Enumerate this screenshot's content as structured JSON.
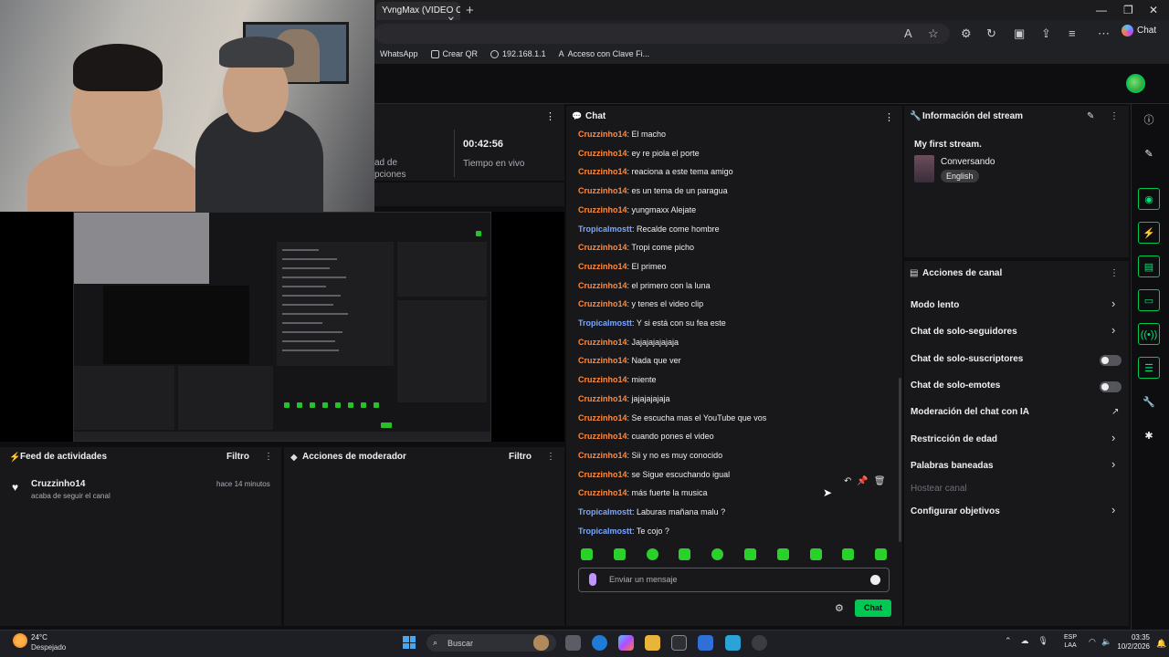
{
  "browser": {
    "tab_title": "YvngMax (VIDEO OF",
    "tab_close": "✕",
    "new_tab": "+",
    "copilot_label": "Chat",
    "bookmarks": [
      "WhatsApp",
      "Crear QR",
      "192.168.1.1",
      "Acceso con Clave Fi..."
    ]
  },
  "stats": {
    "label_partial": "ad de\npciones",
    "uptime": "00:42:56",
    "uptime_label": "Tiempo en vivo"
  },
  "activity": {
    "title": "Feed de actividades",
    "filter": "Filtro",
    "event_user": "Cruzzinho14",
    "event_text": "acaba de seguir el canal",
    "event_time": "hace 14 minutos"
  },
  "mod_actions": {
    "title": "Acciones de moderador",
    "filter": "Filtro"
  },
  "chat": {
    "title": "Chat",
    "messages": [
      {
        "user": "Cruzzinho14",
        "color": "cruz",
        "text": "El macho"
      },
      {
        "user": "Cruzzinho14",
        "color": "cruz",
        "text": "ey re piola el porte"
      },
      {
        "user": "Cruzzinho14",
        "color": "cruz",
        "text": "reaciona a este tema amigo"
      },
      {
        "user": "Cruzzinho14",
        "color": "cruz",
        "text": "es un tema de un paragua"
      },
      {
        "user": "Cruzzinho14",
        "color": "cruz",
        "text": "yungmaxx Alejate"
      },
      {
        "user": "Tropicalmostt",
        "color": "trop",
        "text": "Recalde come hombre"
      },
      {
        "user": "Cruzzinho14",
        "color": "cruz",
        "text": "Tropi come picho"
      },
      {
        "user": "Cruzzinho14",
        "color": "cruz",
        "text": "El primeo"
      },
      {
        "user": "Cruzzinho14",
        "color": "cruz",
        "text": "el primero con la luna"
      },
      {
        "user": "Cruzzinho14",
        "color": "cruz",
        "text": "y tenes el video clip"
      },
      {
        "user": "Tropicalmostt",
        "color": "trop",
        "text": "Y si está con su fea este"
      },
      {
        "user": "Cruzzinho14",
        "color": "cruz",
        "text": "Jajajajajajaja"
      },
      {
        "user": "Cruzzinho14",
        "color": "cruz",
        "text": "Nada que ver"
      },
      {
        "user": "Cruzzinho14",
        "color": "cruz",
        "text": "miente"
      },
      {
        "user": "Cruzzinho14",
        "color": "cruz",
        "text": "jajajajajaja"
      },
      {
        "user": "Cruzzinho14",
        "color": "cruz",
        "text": "Se escucha mas el YouTube que vos"
      },
      {
        "user": "Cruzzinho14",
        "color": "cruz",
        "text": "cuando pones el video"
      },
      {
        "user": "Cruzzinho14",
        "color": "cruz",
        "text": "Sii y no es muy conocido"
      },
      {
        "user": "Cruzzinho14",
        "color": "cruz",
        "text": "se Sigue escuchando igual"
      },
      {
        "user": "Cruzzinho14",
        "color": "cruz",
        "text": "más fuerte la musica"
      },
      {
        "user": "Tropicalmostt",
        "color": "trop",
        "text": "Laburas mañana malu ?"
      },
      {
        "user": "Tropicalmostt",
        "color": "trop",
        "text": "Te cojo ?"
      }
    ],
    "input_placeholder": "Enviar un mensaje",
    "send_label": "Chat"
  },
  "stream_info": {
    "title": "Información del stream",
    "stream_title": "My first stream.",
    "category": "Conversando",
    "language": "English"
  },
  "channel_actions": {
    "title": "Acciones de canal",
    "items": [
      {
        "label": "Modo lento",
        "control": "chevron"
      },
      {
        "label": "Chat de solo-seguidores",
        "control": "chevron"
      },
      {
        "label": "Chat de solo-suscriptores",
        "control": "toggle"
      },
      {
        "label": "Chat de solo-emotes",
        "control": "toggle"
      },
      {
        "label": "Moderación del chat con IA",
        "control": "external"
      },
      {
        "label": "Restricción de edad",
        "control": "chevron"
      },
      {
        "label": "Palabras baneadas",
        "control": "chevron"
      },
      {
        "label": "Hostear canal",
        "control": "disabled"
      },
      {
        "label": "Configurar objetivos",
        "control": "chevron"
      }
    ]
  },
  "taskbar": {
    "temp": "24°C",
    "weather": "Despejado",
    "search": "Buscar",
    "lang_1": "ESP",
    "lang_2": "LAA",
    "time": "03:35",
    "date": "10/2/2026"
  },
  "colors": {
    "accent_green": "#00c853",
    "user_orange": "#ff8a3d",
    "user_blue": "#7aa7ff"
  }
}
